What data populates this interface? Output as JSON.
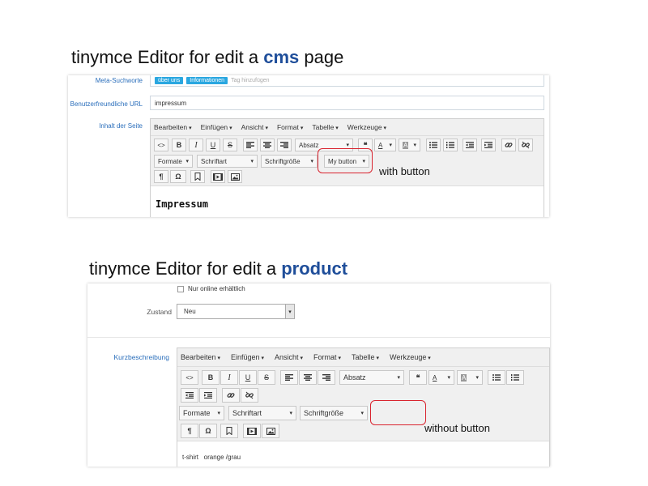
{
  "cms": {
    "heading_prefix": "tinymce Editor for edit a ",
    "heading_highlight": "cms",
    "heading_suffix": " page",
    "meta_label": "Meta-Suchworte",
    "tags": [
      "über uns",
      "Informationen"
    ],
    "tag_placeholder": "Tag hinzufügen",
    "url_label": "Benutzerfreundliche URL",
    "url_value": "impressum",
    "content_label": "Inhalt der Seite",
    "menu": [
      "Bearbeiten",
      "Einfügen",
      "Ansicht",
      "Format",
      "Tabelle",
      "Werkzeuge"
    ],
    "block_format": "Absatz",
    "formats": "Formate",
    "font_family": "Schriftart",
    "font_size": "Schriftgröße",
    "custom_button": "My button",
    "annotation": "with button",
    "content_heading": "Impressum"
  },
  "product": {
    "heading_prefix": "tinymce Editor for edit a ",
    "heading_highlight": "product",
    "online_label": "Nur online erhältlich",
    "zustand_label": "Zustand",
    "zustand_value": "Neu",
    "short_desc_label": "Kurzbeschreibung",
    "menu": [
      "Bearbeiten",
      "Einfügen",
      "Ansicht",
      "Format",
      "Tabelle",
      "Werkzeuge"
    ],
    "block_format": "Absatz",
    "formats": "Formate",
    "font_family": "Schriftart",
    "font_size": "Schriftgröße",
    "annotation": "without button",
    "content_text": "t-shirt   orange /grau"
  },
  "toolbar_glyphs": {
    "code": "<>",
    "bold": "B",
    "italic": "I",
    "underline": "U",
    "strike": "S",
    "pilcrow": "¶",
    "omega": "Ω",
    "text_color": "A",
    "bg_color": "A",
    "quote": "❝"
  },
  "colors": {
    "highlight": "#1f4e9a",
    "tag_bg": "#2aa7e0",
    "red_box": "#d9232e",
    "label_blue": "#2a6ebb"
  }
}
